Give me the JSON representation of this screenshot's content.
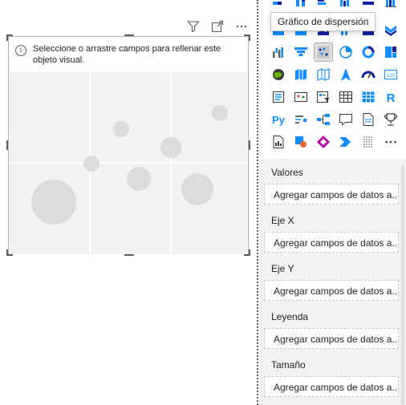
{
  "canvas": {
    "toolbar": {
      "icons": [
        "filter-icon",
        "focus-mode-icon",
        "more-options-icon"
      ]
    },
    "visual": {
      "message": "Seleccione o arrastre campos para rellenar este objeto visual.",
      "preview": "scatter-placeholder"
    }
  },
  "viz_pane": {
    "tooltip": "Gráfico de dispersión",
    "icons": [
      "stacked-bar-icon",
      "stacked-column-icon",
      "clustered-bar-icon",
      "clustered-column-icon",
      "100-bar-icon",
      "100-column-icon",
      "line-icon",
      "area-icon",
      "stacked-area-icon",
      "line-column-icon",
      "line-clustered-column-icon",
      "ribbon-icon",
      "waterfall-icon",
      "funnel-icon",
      "scatter-icon",
      "pie-icon",
      "donut-icon",
      "treemap-icon",
      "map-icon",
      "filled-map-icon",
      "shape-map-icon",
      "azure-map-icon",
      "gauge-icon",
      "card-icon",
      "multi-row-card-icon",
      "kpi-icon",
      "slicer-icon",
      "table-icon",
      "matrix-icon",
      "r-visual-icon",
      "python-visual-icon",
      "key-influencers-icon",
      "decomposition-tree-icon",
      "qa-icon",
      "smart-narrative-icon",
      "goals-icon",
      "paginated-report-icon",
      "power-automate-icon",
      "power-apps-icon",
      "power-automate-flow-icon",
      "custom-visual-icon",
      "more-visuals-icon"
    ],
    "wells": [
      {
        "label": "Valores",
        "placeholder": "Agregar campos de datos a..."
      },
      {
        "label": "Eje X",
        "placeholder": "Agregar campos de datos a..."
      },
      {
        "label": "Eje Y",
        "placeholder": "Agregar campos de datos a..."
      },
      {
        "label": "Leyenda",
        "placeholder": "Agregar campos de datos a..."
      },
      {
        "label": "Tamaño",
        "placeholder": "Agregar campos de datos a..."
      }
    ]
  },
  "colors": {
    "accent_blue": "#118dff",
    "dark_blue": "#12239e",
    "orange": "#e66c37",
    "purple": "#6b007b",
    "teal": "#3ec6bb",
    "placeholder_bubble": "#dcdcdc"
  }
}
